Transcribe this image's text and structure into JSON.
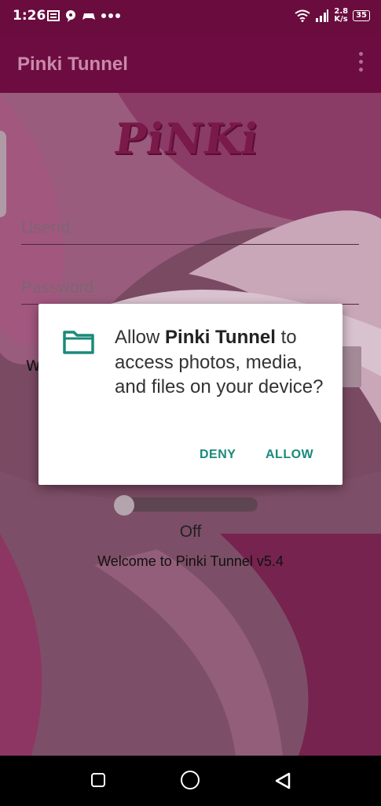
{
  "status": {
    "time": "1:26",
    "speed_top": "2.8",
    "speed_unit": "K/s",
    "battery": "35"
  },
  "app_bar": {
    "title": "Pinki Tunnel"
  },
  "logo": {
    "text": "PiNKi"
  },
  "form": {
    "userid_placeholder": "UserId",
    "password_placeholder": "Password",
    "partial_label": "W"
  },
  "toggle": {
    "state_label": "Off"
  },
  "welcome": {
    "text": "Welcome to  Pinki Tunnel v5.4"
  },
  "dialog": {
    "prefix": "Allow ",
    "app_name": "Pinki Tunnel",
    "suffix": " to access photos, media, and files on your device?",
    "deny_label": "DENY",
    "allow_label": "ALLOW",
    "icon": "folder-icon"
  },
  "colors": {
    "accent": "#1a8a7a",
    "app_bar": "#6c0c40"
  }
}
